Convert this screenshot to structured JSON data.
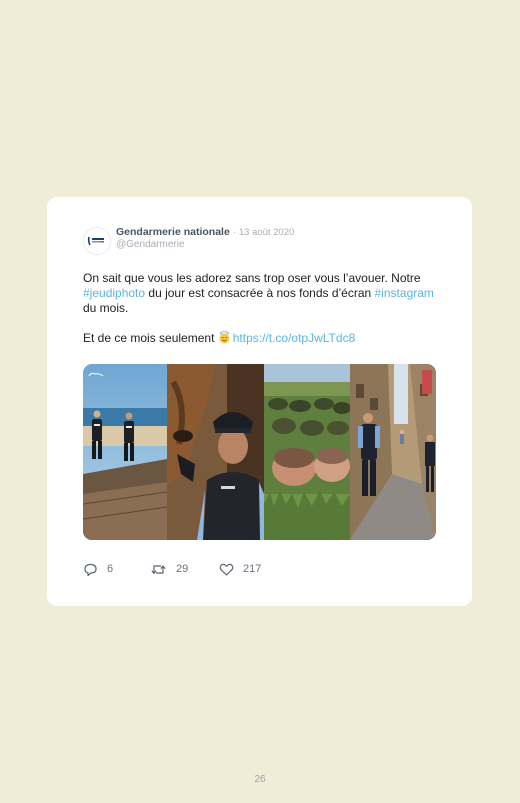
{
  "tweet": {
    "author_name": "Gendarmerie nationale",
    "separator": "·",
    "date": "13 août 2020",
    "handle": "@Gendarmerie",
    "paragraph1": {
      "t1": "On sait que vous les adorez sans trop oser vous l’avouer. Notre ",
      "hashtag1": "#jeudiphoto",
      "t2": " du jour est consacrée à nos fonds d’écran ",
      "hashtag2": "#instagram",
      "t3": " du mois."
    },
    "paragraph2": {
      "t1": "Et de ce mois seulement ",
      "emoji": "smiling-face-with-halo",
      "link": "https://t.co/otpJwLTdc8"
    },
    "media": [
      "beach-promenade-patrol-photo",
      "gendarme-with-horse-photo",
      "recruits-training-grass-photo",
      "street-patrol-photo"
    ],
    "actions": {
      "replies": "6",
      "retweets": "29",
      "likes": "217"
    }
  },
  "page_number": "26",
  "colors": {
    "background": "#efecd8",
    "card": "#ffffff",
    "link": "#5ab4e6",
    "author": "#4a5565",
    "muted": "#a8adb5"
  }
}
